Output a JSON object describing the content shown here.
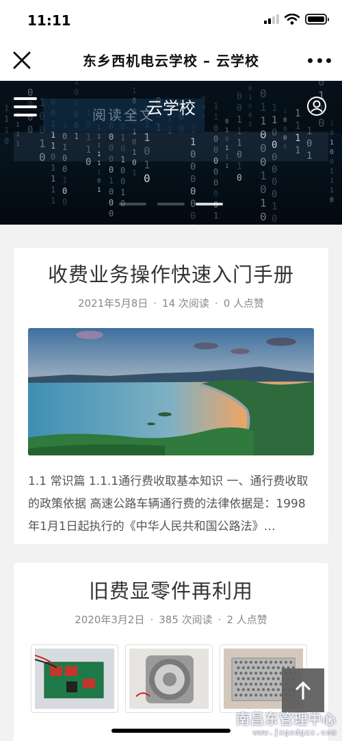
{
  "status_bar": {
    "time": "11:11"
  },
  "nav": {
    "title": "东乡西机电云学校 – 云学校"
  },
  "banner": {
    "title": "云学校",
    "read_all_label": "阅读全文",
    "slides_count": 3,
    "active_slide": 3
  },
  "articles": [
    {
      "title": "收费业务操作快速入门手册",
      "date": "2021年5月8日",
      "reads": "14 次阅读",
      "likes": "0 人点赞",
      "image_desc": "lake-sunset-landscape",
      "excerpt": "1.1 常识篇 1.1.1通行费收取基本知识 一、通行费收取的政策依据 高速公路车辆通行费的法律依据是：1998年1月1日起执行的《中华人民共和国公路法》…"
    },
    {
      "title": "旧费显零件再利用",
      "date": "2020年3月2日",
      "reads": "385 次阅读",
      "likes": "2 人点赞",
      "thumbnails": [
        "circuit-board",
        "speaker",
        "power-supply"
      ]
    }
  ],
  "meta_separator": "·",
  "watermark": {
    "cn": "南昌东管理中心",
    "en": "www.jxgsdgzx.com"
  },
  "colors": {
    "banner_bg": "#06121c",
    "page_bg": "#f2f2f2",
    "back_top_bg": "#5c5c5c"
  }
}
